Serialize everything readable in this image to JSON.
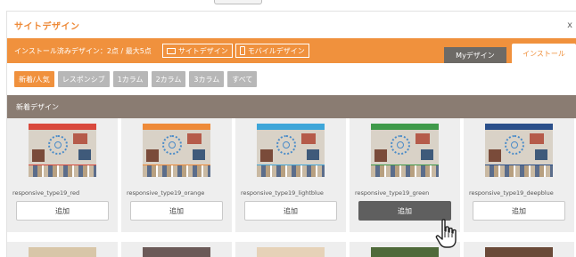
{
  "dialog": {
    "title": "サイトデザイン",
    "close": "x"
  },
  "toolbar": {
    "install_info": "インストール済みデザイン：2点 / 最大5点",
    "site_design_label": "サイトデザイン",
    "mobile_design_label": "モバイルデザイン",
    "tab_my": "Myデザイン",
    "tab_install": "インストール"
  },
  "filters": [
    {
      "label": "新着/人気",
      "active": true
    },
    {
      "label": "レスポンシブ",
      "active": false
    },
    {
      "label": "1カラム",
      "active": false
    },
    {
      "label": "2カラム",
      "active": false
    },
    {
      "label": "3カラム",
      "active": false
    },
    {
      "label": "すべて",
      "active": false
    }
  ],
  "section": {
    "title": "新着デザイン"
  },
  "cards": [
    {
      "name": "responsive_type19_red",
      "add_label": "追加",
      "accent": "#d9493d"
    },
    {
      "name": "responsive_type19_orange",
      "add_label": "追加",
      "accent": "#ee8a38"
    },
    {
      "name": "responsive_type19_lightblue",
      "add_label": "追加",
      "accent": "#3ea6d9"
    },
    {
      "name": "responsive_type19_green",
      "add_label": "追加",
      "accent": "#3f9a4a"
    },
    {
      "name": "responsive_type19_deepblue",
      "add_label": "追加",
      "accent": "#2a4f8a"
    }
  ],
  "row2_accents": [
    "#d8c6a8",
    "#6b5a58",
    "#e6d2b8",
    "#4f6a3a",
    "#6a4a38"
  ],
  "colors": {
    "brand_orange": "#f0913d",
    "section_brown": "#8a7c72",
    "filter_gray": "#b7b7b7"
  },
  "icons": {
    "site_design": "monitor-icon",
    "mobile_design": "smartphone-icon",
    "cursor": "hand-pointer-icon"
  }
}
